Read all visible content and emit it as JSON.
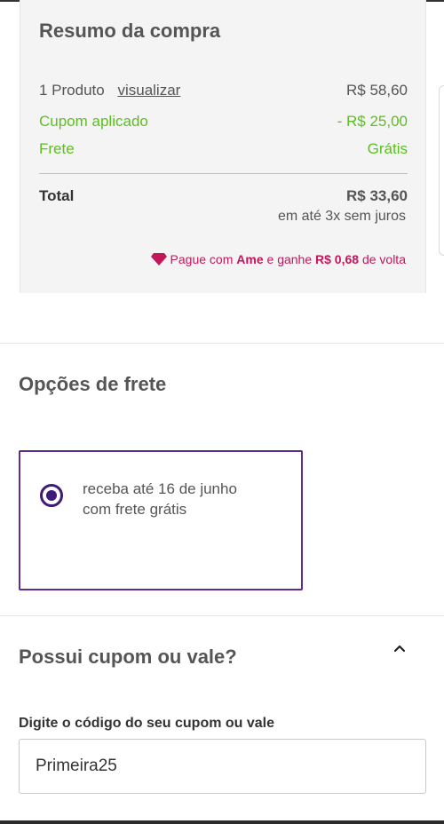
{
  "summary": {
    "title": "Resumo da compra",
    "products_label": "1 Produto",
    "view_link": "visualizar",
    "products_value": "R$ 58,60",
    "coupon_label": "Cupom aplicado",
    "coupon_value": "- R$ 25,00",
    "shipping_label": "Frete",
    "shipping_value": "Grátis",
    "total_label": "Total",
    "total_value": "R$ 33,60",
    "installments": "em até 3x sem juros",
    "ame": {
      "prefix": "Pague com",
      "brand": "Ame",
      "middle": "e ganhe",
      "cashback": "R$ 0,68",
      "suffix": "de volta",
      "color": "#c2185b"
    }
  },
  "shipping_options": {
    "title": "Opções de frete",
    "selected_option": {
      "line1": "receba até 16 de junho",
      "line2": "com frete grátis"
    }
  },
  "coupon": {
    "title": "Possui cupom ou vale?",
    "toggle_icon": "chevron-up-icon",
    "input_label": "Digite o código do seu cupom ou vale",
    "input_value": "Primeira25"
  },
  "colors": {
    "accent_green": "#5cbf1f",
    "accent_purple": "#5d2d91",
    "ame_pink": "#c2185b"
  }
}
